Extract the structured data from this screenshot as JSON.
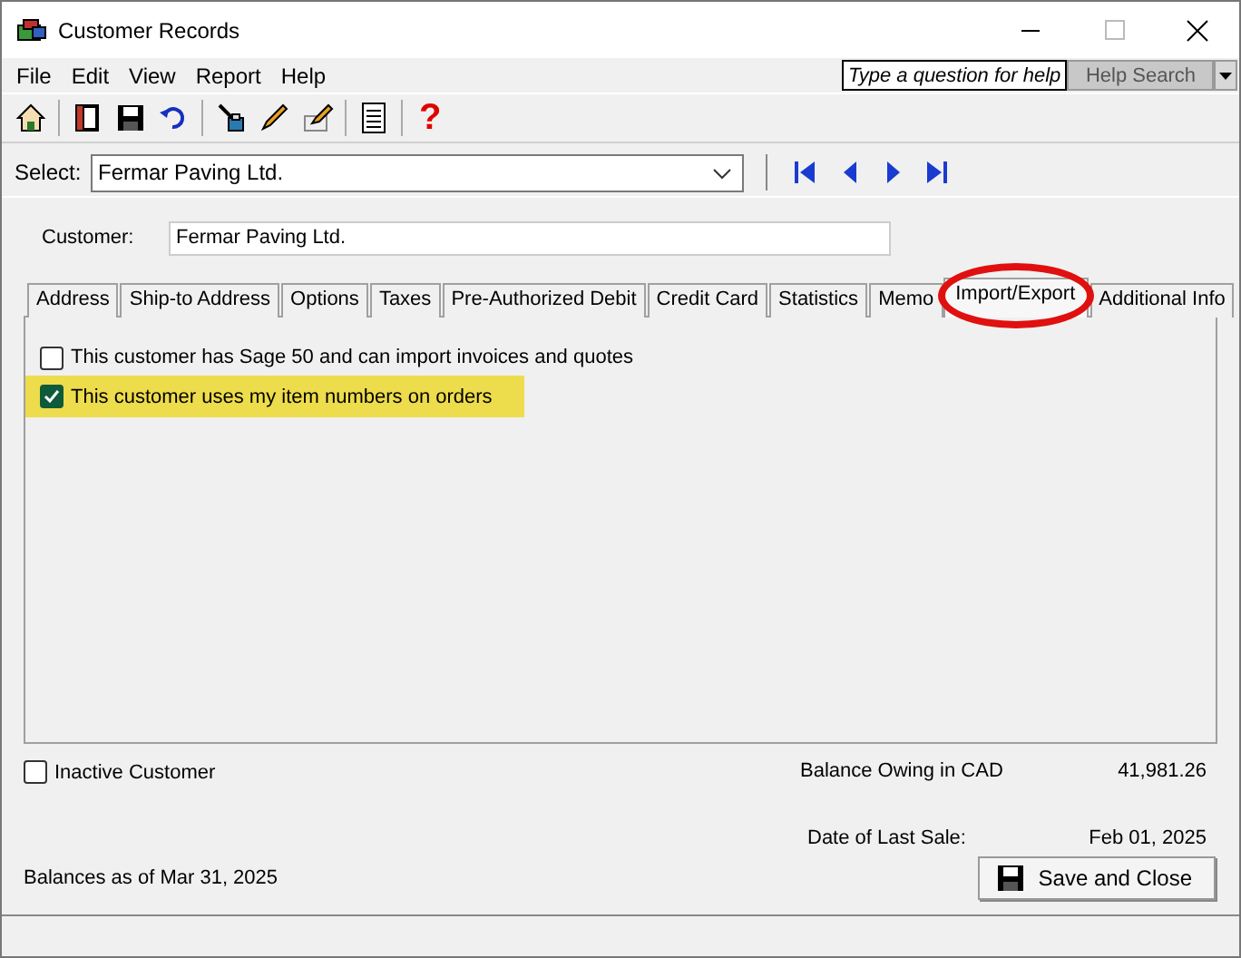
{
  "window": {
    "title": "Customer Records"
  },
  "menu": [
    "File",
    "Edit",
    "View",
    "Report",
    "Help"
  ],
  "help": {
    "placeholder": "Type a question for help",
    "button": "Help Search"
  },
  "toolbar": [
    {
      "kind": "home"
    },
    {
      "kind": "book"
    },
    {
      "kind": "save"
    },
    {
      "kind": "undo"
    },
    {
      "kind": "brush"
    },
    {
      "kind": "pen"
    },
    {
      "kind": "note"
    },
    {
      "kind": "list"
    },
    {
      "kind": "help",
      "glyph": "?"
    }
  ],
  "select": {
    "label": "Select:",
    "value": "Fermar Paving Ltd."
  },
  "customer": {
    "label": "Customer:",
    "value": "Fermar Paving Ltd."
  },
  "tabs": [
    {
      "label": "Address",
      "selected": false
    },
    {
      "label": "Ship-to Address",
      "selected": false
    },
    {
      "label": "Options",
      "selected": false
    },
    {
      "label": "Taxes",
      "selected": false
    },
    {
      "label": "Pre-Authorized Debit",
      "selected": false
    },
    {
      "label": "Credit Card",
      "selected": false
    },
    {
      "label": "Statistics",
      "selected": false
    },
    {
      "label": "Memo",
      "selected": false
    },
    {
      "label": "Import/Export",
      "selected": true
    },
    {
      "label": "Additional Info",
      "selected": false
    }
  ],
  "annotation": {
    "kind": "ellipse"
  },
  "options": [
    {
      "label": "This customer has Sage 50 and can import invoices and quotes",
      "checked": false,
      "highlighted": false
    },
    {
      "label": "This customer uses my item numbers on orders",
      "checked": true,
      "highlighted": true
    }
  ],
  "inactive": {
    "label": "Inactive Customer",
    "checked": false
  },
  "balance": {
    "label": "Balance Owing in CAD",
    "value": "41,981.26"
  },
  "last_sale": {
    "label": "Date of Last Sale:",
    "value": "Feb 01, 2025"
  },
  "balances_note": "Balances as of Mar 31, 2025",
  "save_button": {
    "label": "Save and Close"
  }
}
